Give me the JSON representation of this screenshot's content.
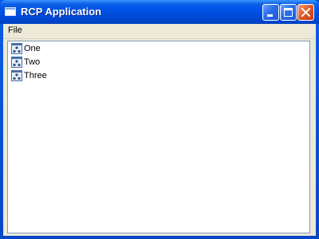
{
  "window": {
    "title": "RCP Application"
  },
  "menubar": {
    "items": [
      {
        "label": "File"
      }
    ]
  },
  "tree": {
    "items": [
      {
        "label": "One",
        "icon": "element-icon"
      },
      {
        "label": "Two",
        "icon": "element-icon"
      },
      {
        "label": "Three",
        "icon": "element-icon"
      }
    ]
  },
  "colors": {
    "titlebar": "#0054e3",
    "client_background": "#ece9d8",
    "tree_background": "#ffffff",
    "tree_border": "#7f9db9",
    "close_button": "#e05b2c"
  }
}
